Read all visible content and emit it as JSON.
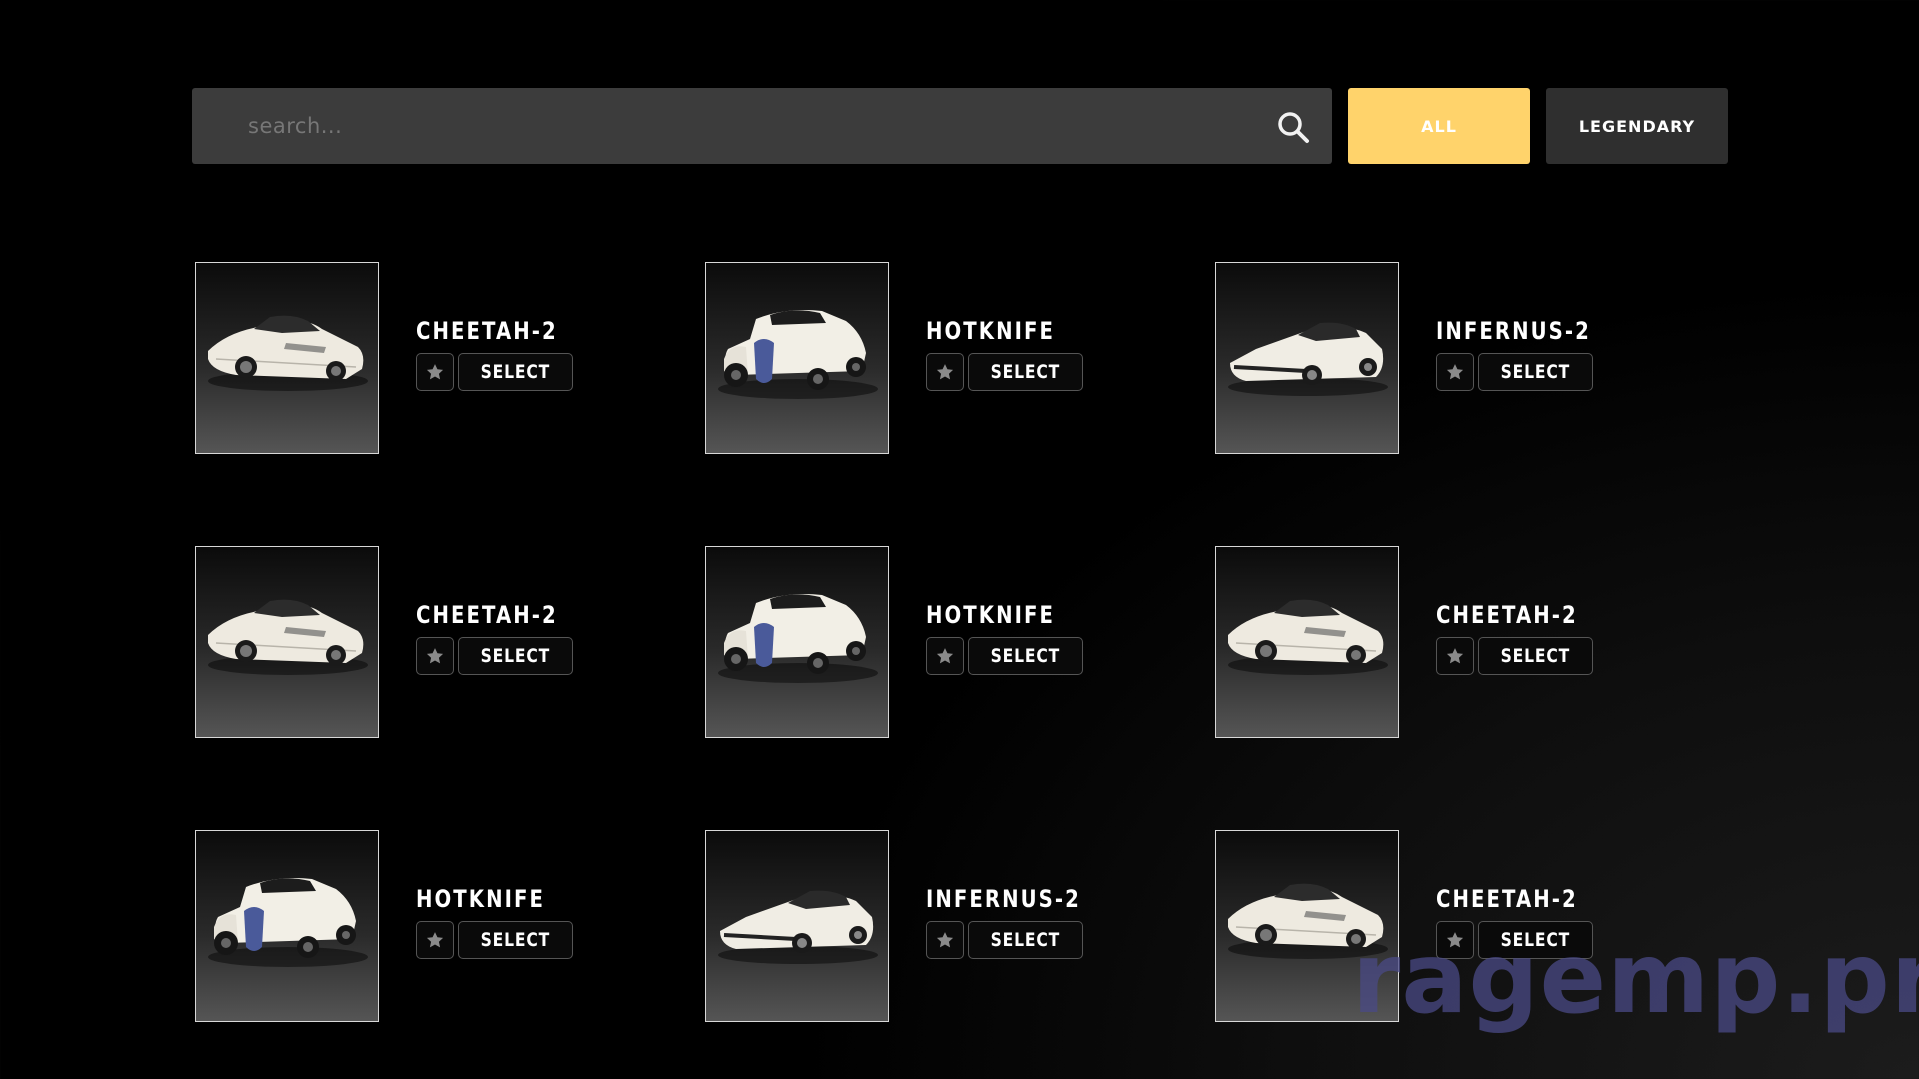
{
  "search": {
    "placeholder": "search..."
  },
  "filters": [
    {
      "label": "ALL",
      "active": true
    },
    {
      "label": "LEGENDARY",
      "active": false
    }
  ],
  "colors": {
    "accent": "#ffd36b",
    "background": "#000000",
    "panel": "#3c3c3c"
  },
  "select_label": "SELECT",
  "vehicles": [
    {
      "name": "CHEETAH-2",
      "model": "cheetah"
    },
    {
      "name": "HOTKNIFE",
      "model": "hotknife"
    },
    {
      "name": "INFERNUS-2",
      "model": "infernus"
    },
    {
      "name": "CHEETAH-2",
      "model": "cheetah"
    },
    {
      "name": "HOTKNIFE",
      "model": "hotknife"
    },
    {
      "name": "CHEETAH-2",
      "model": "cheetah"
    },
    {
      "name": "HOTKNIFE",
      "model": "hotknife"
    },
    {
      "name": "INFERNUS-2",
      "model": "infernus"
    },
    {
      "name": "CHEETAH-2",
      "model": "cheetah"
    }
  ],
  "watermark": "ragemp.pro"
}
